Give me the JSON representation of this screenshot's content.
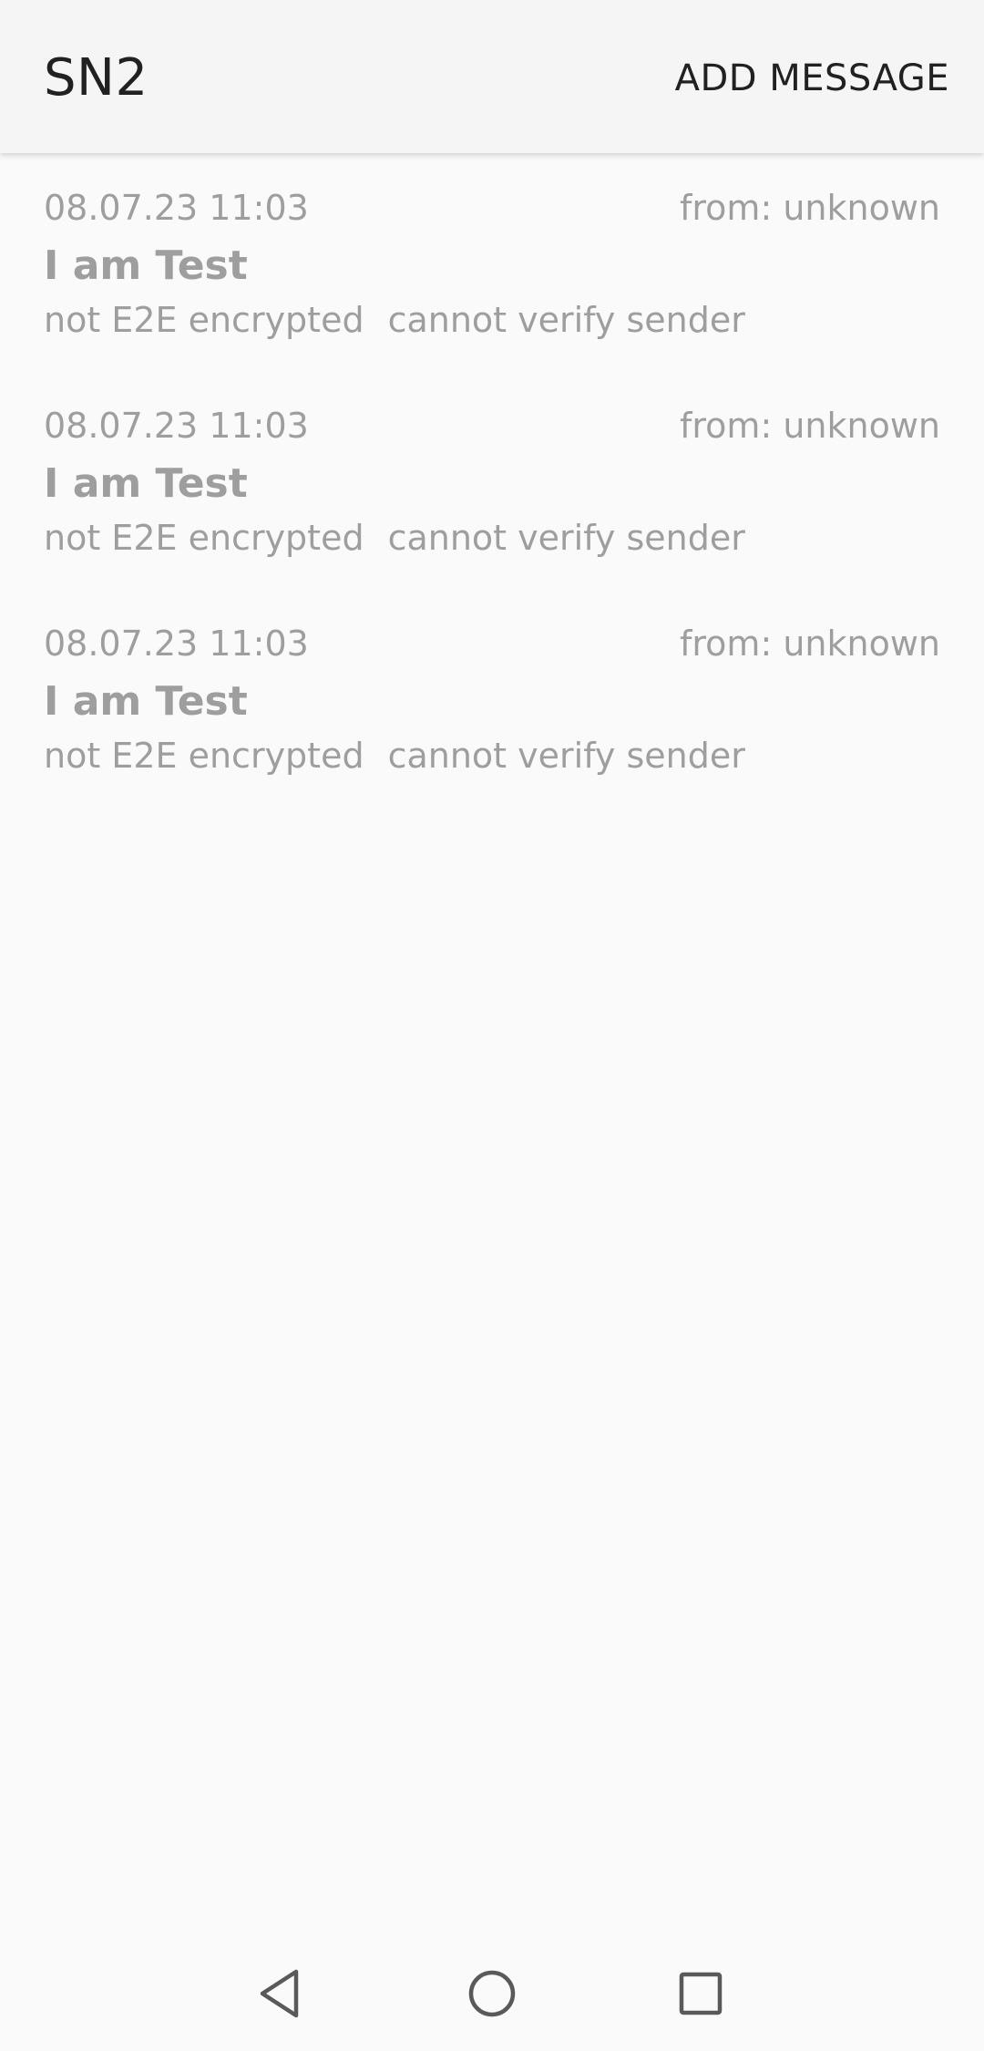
{
  "app_bar": {
    "title": "SN2",
    "add_message_label": "ADD MESSAGE"
  },
  "messages": [
    {
      "date": "08.07.23 11:03",
      "from": "from: unknown",
      "text": "I am Test",
      "encryption": "not E2E encrypted",
      "verification": "cannot verify sender"
    },
    {
      "date": "08.07.23 11:03",
      "from": "from: unknown",
      "text": "I am Test",
      "encryption": "not E2E encrypted",
      "verification": "cannot verify sender"
    },
    {
      "date": "08.07.23 11:03",
      "from": "from: unknown",
      "text": "I am Test",
      "encryption": "not E2E encrypted",
      "verification": "cannot verify sender"
    }
  ],
  "nav_bar": {
    "icons": [
      "back-icon",
      "home-icon",
      "recents-icon"
    ]
  },
  "colors": {
    "app_bar_background": "#f5f5f5",
    "page_background": "#fafafa",
    "primary_text": "#212121",
    "secondary_text": "#9e9e9e"
  }
}
